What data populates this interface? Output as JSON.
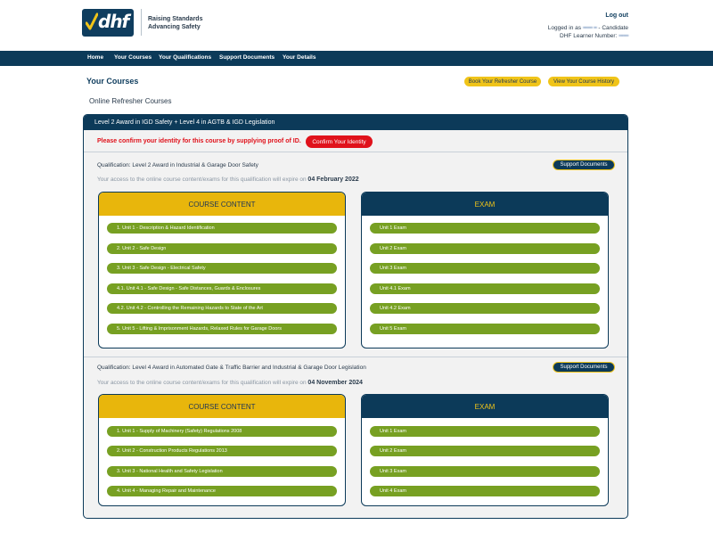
{
  "header": {
    "logo_text": "dhf",
    "tagline_line1": "Raising Standards",
    "tagline_line2": "Advancing Safety",
    "logout_label": "Log out",
    "logged_in_prefix": "Logged in as",
    "logged_in_suffix": "- Candidate",
    "learner_label": "DHF Learner Number:"
  },
  "nav": {
    "items": [
      "Home",
      "Your Courses",
      "Your Qualifications",
      "Support Documents",
      "Your Details"
    ]
  },
  "page": {
    "title": "Your Courses",
    "book_refresher_label": "Book Your Refresher Course",
    "history_label": "View Your Course History",
    "subheading": "Online Refresher Courses"
  },
  "course": {
    "title": "Level 2 Award in IGD Safety + Level 4 in AGTB & IGD Legislation",
    "notice": "Please confirm your identity for this course by supplying proof of ID.",
    "confirm_label": "Confirm Your Identity"
  },
  "qualifications": [
    {
      "title": "Qualification: Level 2 Award in Industrial & Garage Door Safety",
      "access_text": "Your access to the online course content/exams for this qualification will expire on",
      "expiry": "04 February 2022",
      "support_label": "Support Documents",
      "content_heading": "COURSE CONTENT",
      "exam_heading": "EXAM",
      "units": [
        "1. Unit 1 - Description & Hazard Identification",
        "2. Unit 2 - Safe Design",
        "3. Unit 3 - Safe Design - Electrical Safety",
        "4.1. Unit 4.1 - Safe Design - Safe Distances, Guards & Enclosures",
        "4.2. Unit 4.2 - Controlling the Remaining Hazards to State of the Art",
        "5. Unit 5 - Lifting & Imprisonment Hazards, Relaxed Rules for Garage Doors"
      ],
      "exams": [
        "Unit 1 Exam",
        "Unit 2 Exam",
        "Unit 3 Exam",
        "Unit 4.1 Exam",
        "Unit 4.2 Exam",
        "Unit 5 Exam"
      ]
    },
    {
      "title": "Qualification: Level 4 Award in Automated Gate & Traffic Barrier and Industrial & Garage Door Legislation",
      "access_text": "Your access to the online course content/exams for this qualification will expire on",
      "expiry": "04 November 2024",
      "support_label": "Support Documents",
      "content_heading": "COURSE CONTENT",
      "exam_heading": "EXAM",
      "units": [
        "1. Unit 1 - Supply of Machinery (Safety) Regulations 2008",
        "2. Unit 2 - Construction Products Regulations 2013",
        "3. Unit 3 - National Health and Safety Legislation",
        "4. Unit 4 - Managing Repair and Maintenance"
      ],
      "exams": [
        "Unit 1 Exam",
        "Unit 2 Exam",
        "Unit 3 Exam",
        "Unit 4 Exam"
      ]
    }
  ],
  "colors": {
    "navy": "#0c3a59",
    "yellow": "#f0c419",
    "green": "#77a022",
    "red": "#e0121b"
  }
}
